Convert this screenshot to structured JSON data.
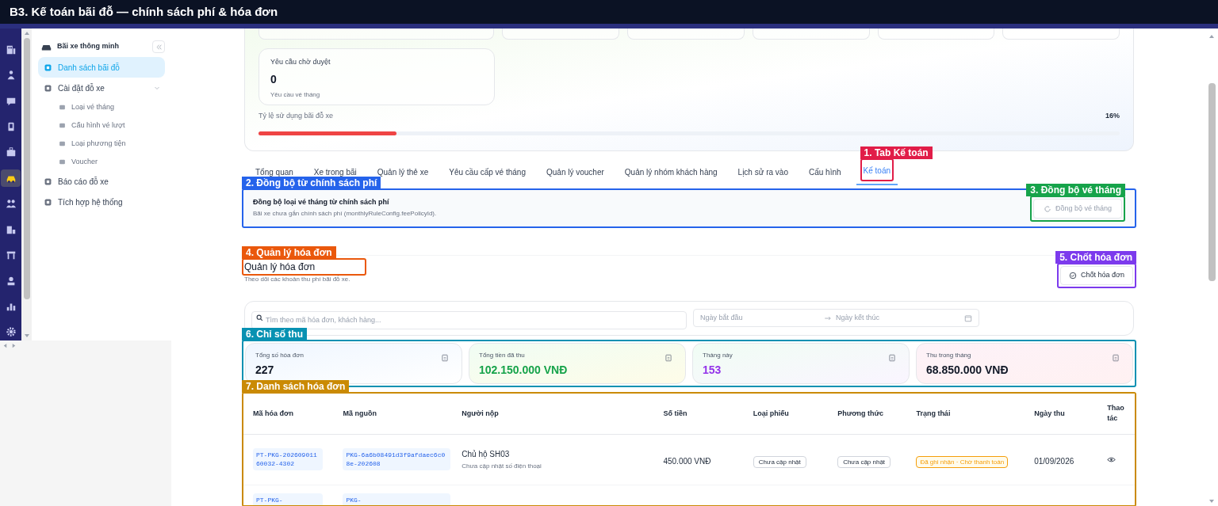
{
  "window": {
    "title": "B3. Kế toán bãi đỗ — chính sách phí & hóa đơn"
  },
  "rail": [
    {
      "selected": false
    },
    {
      "selected": false
    },
    {
      "selected": false
    },
    {
      "selected": false
    },
    {
      "selected": false
    },
    {
      "selected": true
    },
    {
      "selected": false
    },
    {
      "selected": false
    },
    {
      "selected": false
    },
    {
      "selected": false
    },
    {
      "selected": false
    },
    {
      "selected": false
    }
  ],
  "sidebar": {
    "title": "Bãi xe thông minh",
    "items": [
      {
        "label": "Danh sách bãi đỗ",
        "selected": true
      },
      {
        "label": "Cài đặt đỗ xe",
        "selected": false,
        "expanded": true,
        "children": [
          {
            "label": "Loại vé tháng",
            "selected": false
          },
          {
            "label": "Cấu hình vé lượt",
            "selected": false
          },
          {
            "label": "Loại phương tiện",
            "selected": false
          },
          {
            "label": "Voucher",
            "selected": false
          }
        ]
      },
      {
        "label": "Báo cáo đỗ xe",
        "selected": false
      },
      {
        "label": "Tích hợp hệ thống",
        "selected": false
      }
    ]
  },
  "overview": {
    "pending_card": {
      "title": "Yêu cầu chờ duyệt",
      "value": "0",
      "caption": "Yêu cầu vé tháng"
    },
    "usage": {
      "label": "Tỷ lệ sử dụng bãi đỗ xe",
      "reading": "16%",
      "level": 0.16
    }
  },
  "tabs": [
    {
      "label": "Tổng quan",
      "selected": false
    },
    {
      "label": "Xe trong bãi",
      "selected": false
    },
    {
      "label": "Quản lý thẻ xe",
      "selected": false
    },
    {
      "label": "Yêu cầu cấp vé tháng",
      "selected": false
    },
    {
      "label": "Quản lý voucher",
      "selected": false
    },
    {
      "label": "Quản lý nhóm khách hàng",
      "selected": false
    },
    {
      "label": "Lịch sử ra vào",
      "selected": false
    },
    {
      "label": "Cấu hình",
      "selected": false
    },
    {
      "label": "Kế toán",
      "selected": true,
      "annotation": {
        "label": "1. Tab Kế toán",
        "color": "#e11d48"
      }
    }
  ],
  "sync_panel": {
    "title": "Đồng bộ loại vé tháng từ chính sách phí",
    "description": "Bãi xe chưa gắn chính sách phí (monthlyRuleConfig.feePolicyId).",
    "annotation": {
      "label": "2. Đồng bộ từ chính sách phí",
      "color": "#2563eb"
    },
    "button": {
      "label": "Đồng bộ vé tháng",
      "disabled": true,
      "annotation": {
        "label": "3. Đồng bộ vé tháng",
        "color": "#16a34a"
      }
    }
  },
  "invoices": {
    "title": "Quản lý hóa đơn",
    "title_annotation": {
      "label": "4. Quản lý hóa đơn",
      "color": "#ea580c"
    },
    "subtitle": "Theo dõi các khoản thu phí bãi đỗ xe.",
    "close_button": {
      "label": "Chốt hóa đơn",
      "annotation": {
        "label": "5. Chốt hóa đơn",
        "color": "#7c3aed"
      }
    },
    "search": {
      "placeholder": "Tìm theo mã hóa đơn, khách hàng..."
    },
    "date_start": {
      "placeholder": "Ngày bắt đầu"
    },
    "date_end": {
      "placeholder": "Ngày kết thúc"
    },
    "metrics_annotation": {
      "label": "6. Chỉ số thu",
      "color": "#0891b2"
    },
    "metrics": [
      {
        "label": "Tổng số hóa đơn",
        "value": "227",
        "color": "#111827"
      },
      {
        "label": "Tổng tiền đã thu",
        "value": "102.150.000 VNĐ",
        "color": "#16a34a"
      },
      {
        "label": "Tháng này",
        "value": "153",
        "color": "#9333ea"
      },
      {
        "label": "Thu trong tháng",
        "value": "68.850.000 VNĐ",
        "color": "#111827"
      }
    ],
    "table_annotation": {
      "label": "7. Danh sách hóa đơn",
      "color": "#ca8a04"
    },
    "table": {
      "columns": [
        "Mã hóa đơn",
        "Mã nguồn",
        "Người nộp",
        "Số tiền",
        "Loại phiếu",
        "Phương thức",
        "Trạng thái",
        "Ngày thu",
        "Thao tác"
      ],
      "rows": [
        {
          "invoice_code": "PT-PKG-20260901160032-4302",
          "source_code": "PKG-6a6b08491d3f9afdaec6c08e-202608",
          "payer": "Chủ hộ SH03",
          "payer_note": "Chưa cập nhật số điện thoại",
          "amount": "450.000 VNĐ",
          "type": "Chưa cập nhật",
          "method": "Chưa cập nhật",
          "status": {
            "label": "Đã ghi nhận · Chờ thanh toán",
            "color": "#f59e0b"
          },
          "date": "01/09/2026"
        },
        {
          "invoice_code": "PT-PKG-",
          "source_code": "PKG-"
        }
      ]
    }
  }
}
